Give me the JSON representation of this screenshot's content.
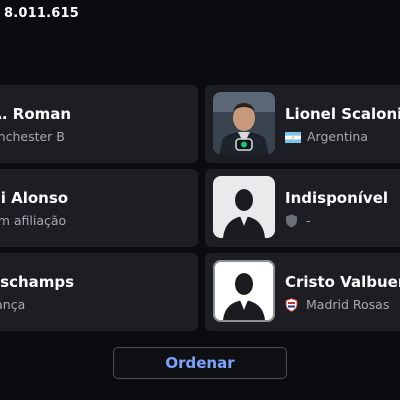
{
  "header": {
    "value": "8.011.615"
  },
  "cards": {
    "left": [
      {
        "name": "A. Roman",
        "sub": "anchester B"
      },
      {
        "name": "bi Alonso",
        "sub": "em afiliação"
      },
      {
        "name": "eschamps",
        "sub": "rança"
      }
    ],
    "right": [
      {
        "name": "Lionel Scaloni",
        "sub": "Argentina",
        "icon": "argentina-flag-icon"
      },
      {
        "name": "Indisponível",
        "sub": "-",
        "icon": "shield-icon"
      },
      {
        "name": "Cristo Valbuena",
        "sub": "Madrid Rosas",
        "icon": "club-crest-icon"
      }
    ]
  },
  "footer": {
    "sort_label": "Ordenar"
  },
  "colors": {
    "card_bg": "#1c1e23",
    "accent_text": "#7da3ff",
    "background": "#0b0c0f"
  }
}
